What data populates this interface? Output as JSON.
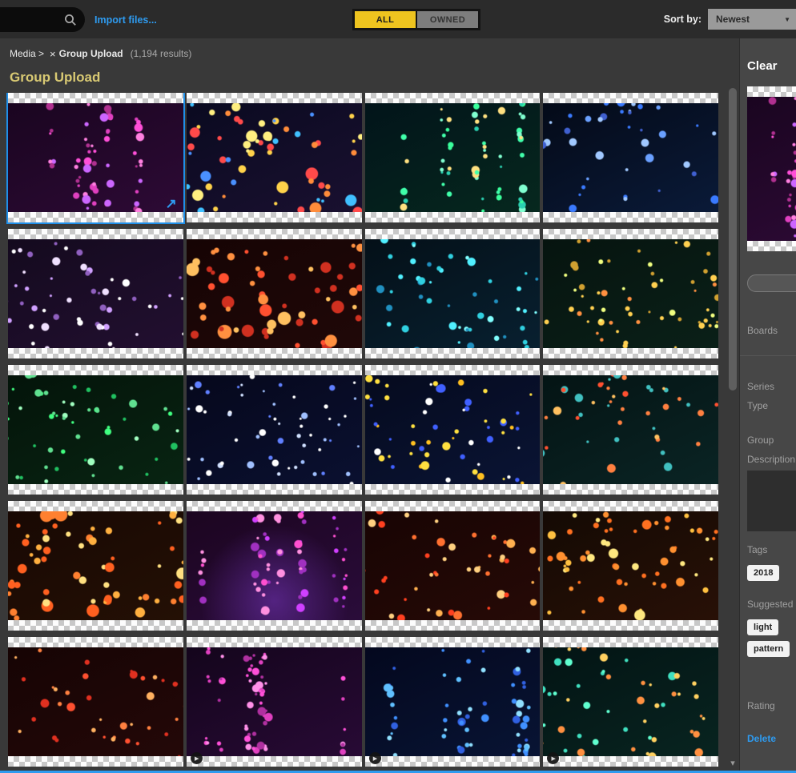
{
  "topbar": {
    "import_label": "Import files...",
    "tabs": [
      {
        "label": "ALL",
        "active": true
      },
      {
        "label": "OWNED",
        "active": false
      }
    ],
    "sort_label": "Sort by:",
    "sort_value": "Newest"
  },
  "breadcrumb": {
    "root": "Media >",
    "filter": "Group Upload",
    "results": "(1,194 results)"
  },
  "page_title": "Group Upload",
  "colors": {
    "accent_blue": "#2e9bf0",
    "accent_yellow": "#eec41f",
    "title_khaki": "#d8c973"
  },
  "tiles": [
    {
      "pattern": "vertical",
      "base": [
        "#1a0520",
        "#2d0a35"
      ],
      "dots": [
        "#ff4fd8",
        "#e040c0",
        "#b03090",
        "#ff80e0",
        "#cc66ff"
      ],
      "selected": true
    },
    {
      "pattern": "scatter",
      "base": [
        "#0a0a20",
        "#1a1030"
      ],
      "dots": [
        "#ff8c3a",
        "#ffd24a",
        "#4a90ff",
        "#ff4a4a",
        "#40c0ff",
        "#ffef80"
      ],
      "dotScale": 1.5
    },
    {
      "pattern": "vertical",
      "base": [
        "#02141a",
        "#06281e"
      ],
      "dots": [
        "#3aff9c",
        "#2ad0b0",
        "#80ffd0",
        "#ffe080",
        "#40ffaa"
      ]
    },
    {
      "pattern": "radial",
      "base": [
        "#040a18",
        "#0a1a38"
      ],
      "dots": [
        "#3a7aff",
        "#6aa0ff",
        "#a0c8ff",
        "#4060d0"
      ]
    },
    {
      "pattern": "diagonal",
      "base": [
        "#140a1e",
        "#220f30"
      ],
      "dots": [
        "#d0a0ff",
        "#f0e0ff",
        "#9060c0",
        "#ffffff"
      ]
    },
    {
      "pattern": "scatter",
      "base": [
        "#160404",
        "#200808"
      ],
      "dots": [
        "#ff5030",
        "#ff9040",
        "#ffc060",
        "#d03020"
      ],
      "dotScale": 1.7
    },
    {
      "pattern": "diagonal",
      "base": [
        "#041018",
        "#082030"
      ],
      "dots": [
        "#30d0e0",
        "#50f0ff",
        "#2090c0",
        "#80ffff"
      ]
    },
    {
      "pattern": "scatter",
      "base": [
        "#06140f",
        "#0a2018"
      ],
      "dots": [
        "#ffd050",
        "#ff9040",
        "#f0ff80",
        "#d0a030"
      ],
      "dotScale": 0.9
    },
    {
      "pattern": "diagonal",
      "base": [
        "#04140a",
        "#082412"
      ],
      "dots": [
        "#40ff80",
        "#20c060",
        "#a0ffc0",
        "#60e090"
      ]
    },
    {
      "pattern": "scatter",
      "base": [
        "#06081c",
        "#0a1030"
      ],
      "dots": [
        "#ffffff",
        "#a0c0ff",
        "#6080ff",
        "#d0e0ff"
      ],
      "dotScale": 0.8
    },
    {
      "pattern": "scatter",
      "base": [
        "#050a1e",
        "#0a1434"
      ],
      "dots": [
        "#ffe040",
        "#4060ff",
        "#ffffff",
        "#ffc020"
      ]
    },
    {
      "pattern": "radial",
      "base": [
        "#041414",
        "#0a2424"
      ],
      "dots": [
        "#ff8040",
        "#ffc060",
        "#40c0c0",
        "#ff5030"
      ]
    },
    {
      "pattern": "scatter",
      "base": [
        "#180803",
        "#241005"
      ],
      "dots": [
        "#ffb040",
        "#ff8030",
        "#ffe080",
        "#ff6020"
      ],
      "dotScale": 1.7
    },
    {
      "pattern": "vertical",
      "base": [
        "#1c0520",
        "#2a0c3a"
      ],
      "dots": [
        "#ff50d0",
        "#d040ff",
        "#ff90e0",
        "#a030c0"
      ],
      "glow": [
        50,
        82,
        "#6a2fa8"
      ]
    },
    {
      "pattern": "diagonal",
      "base": [
        "#180404",
        "#260a06"
      ],
      "dots": [
        "#ff7030",
        "#ffb050",
        "#ff4020",
        "#ffd080"
      ]
    },
    {
      "pattern": "scatter",
      "base": [
        "#140a04",
        "#281006"
      ],
      "dots": [
        "#ffc040",
        "#ff9030",
        "#ffe880",
        "#ff7020"
      ],
      "dotScale": 1.3
    },
    {
      "pattern": "diagonal",
      "base": [
        "#160404",
        "#240808"
      ],
      "dots": [
        "#ff5030",
        "#ff8040",
        "#ffb060",
        "#e03020"
      ]
    },
    {
      "pattern": "vertical",
      "base": [
        "#14051c",
        "#280a35"
      ],
      "dots": [
        "#ff50d8",
        "#e040c0",
        "#ff90e8",
        "#b030a0"
      ],
      "play": true
    },
    {
      "pattern": "vertical",
      "base": [
        "#04081e",
        "#081434"
      ],
      "dots": [
        "#4090ff",
        "#60c0ff",
        "#90e0ff",
        "#3060e0"
      ],
      "play": true
    },
    {
      "pattern": "diagonal",
      "base": [
        "#031414",
        "#082420"
      ],
      "dots": [
        "#40e0c0",
        "#ffd060",
        "#60ffd0",
        "#ff9040"
      ],
      "play": true
    }
  ],
  "panel": {
    "clear_label": "Clear",
    "boards_label": "Boards",
    "series_label": "Series",
    "type_label": "Type",
    "group_label": "Group",
    "description_label": "Description",
    "tags_label": "Tags",
    "tag_chips": [
      "2018"
    ],
    "suggested_label": "Suggested",
    "suggested_chips": [
      "light",
      "pattern"
    ],
    "rating_label": "Rating",
    "delete_label": "Delete"
  }
}
